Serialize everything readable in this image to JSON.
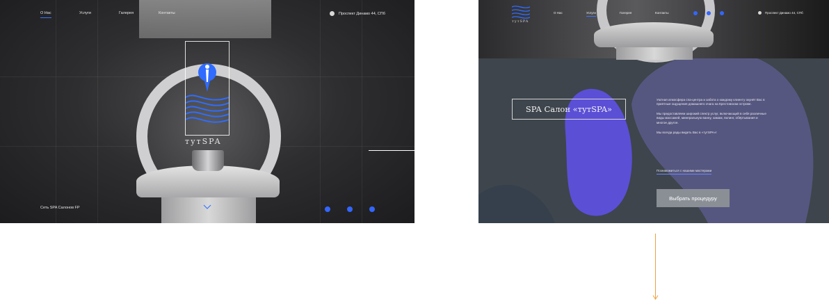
{
  "left_screen": {
    "nav": [
      "О Нас",
      "Услуги",
      "Галерея",
      "Контакты"
    ],
    "active_nav": 0,
    "address": "Проспект Динамо 44, СПб",
    "logo_text": "тутSPA",
    "footer_text": "Сеть SPA Салонов FP",
    "social_icons": [
      "vk-icon",
      "facebook-icon",
      "instagram-icon"
    ]
  },
  "right_screen": {
    "logo_text": "тутSPA",
    "nav": [
      "О Нас",
      "Услуги",
      "Галерея",
      "Контакты"
    ],
    "address": "Проспект Динамо 44, СПб",
    "social_icons": [
      "vk-icon",
      "facebook-icon",
      "instagram-icon"
    ],
    "title": "SPA Салон «тутSPA»",
    "paragraphs": [
      "Уютная атмосфера спа-центра и забота о каждому клиенту окунёт Вас в приятные ощущения домашнего очага на Крестовском острове.",
      "Мы предоставляем широкий спектр услуг, включающий в себя различные виды массажей, минеральную ванну, хамам, пилинг, обёртывания и многое другое.",
      "Мы всегда рады видеть Вас в «тутSPA»!"
    ],
    "link_label": "Познакомиться с нашими мастерами",
    "button_label": "Выбрать процедуру"
  },
  "colors": {
    "accent_blue": "#3366ff",
    "blob_purple": "#5b4fd6",
    "blob_lavender": "#5a5a8a",
    "panel_bg": "#3e454c",
    "orange_line": "#f0a040"
  }
}
